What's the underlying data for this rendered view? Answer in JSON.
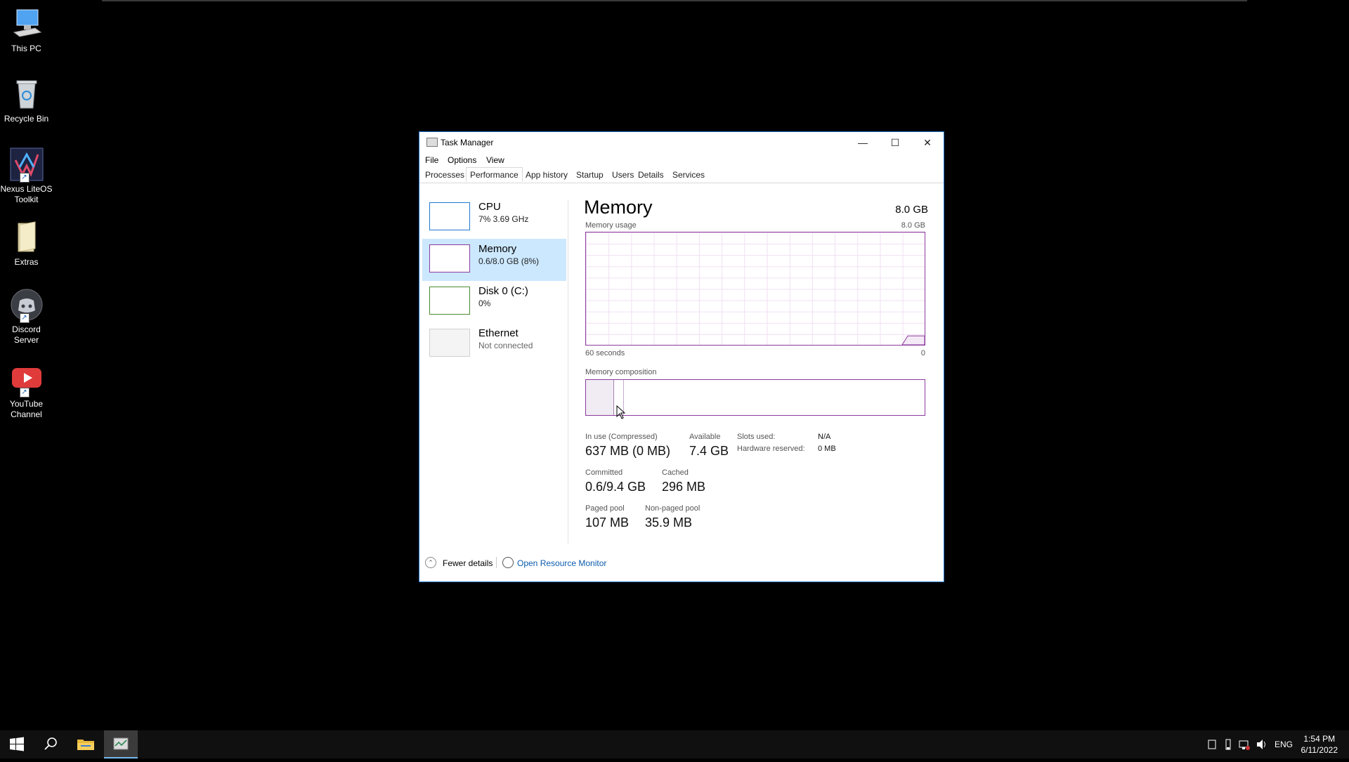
{
  "desktop": {
    "icons": [
      {
        "label": "This PC"
      },
      {
        "label": "Recycle Bin"
      },
      {
        "label": "Nexus LiteOS Toolkit"
      },
      {
        "label": "Extras"
      },
      {
        "label": "Discord Server"
      },
      {
        "label": "YouTube Channel"
      }
    ]
  },
  "window": {
    "title": "Task Manager",
    "menu": [
      "File",
      "Options",
      "View"
    ],
    "tabs": [
      "Processes",
      "Performance",
      "App history",
      "Startup",
      "Users",
      "Details",
      "Services"
    ],
    "active_tab": "Performance"
  },
  "sidebar": {
    "items": [
      {
        "title": "CPU",
        "sub": "7% 3.69 GHz"
      },
      {
        "title": "Memory",
        "sub": "0.6/8.0 GB (8%)"
      },
      {
        "title": "Disk 0 (C:)",
        "sub": "0%"
      },
      {
        "title": "Ethernet",
        "sub": "Not connected"
      }
    ]
  },
  "memory": {
    "title": "Memory",
    "total": "8.0 GB",
    "usage_label": "Memory usage",
    "usage_max": "8.0 GB",
    "time_left": "60 seconds",
    "time_right": "0",
    "usage_fraction": 0.08,
    "composition_label": "Memory composition",
    "stats": {
      "in_use_label": "In use (Compressed)",
      "in_use_value": "637 MB (0 MB)",
      "available_label": "Available",
      "available_value": "7.4 GB",
      "committed_label": "Committed",
      "committed_value": "0.6/9.4 GB",
      "cached_label": "Cached",
      "cached_value": "296 MB",
      "paged_label": "Paged pool",
      "paged_value": "107 MB",
      "nonpaged_label": "Non-paged pool",
      "nonpaged_value": "35.9 MB",
      "slots_label": "Slots used:",
      "slots_value": "N/A",
      "hw_label": "Hardware reserved:",
      "hw_value": "0 MB"
    }
  },
  "footer": {
    "fewer_details": "Fewer details",
    "resource_monitor": "Open Resource Monitor"
  },
  "taskbar": {
    "language": "ENG",
    "time": "1:54 PM",
    "date": "6/11/2022"
  }
}
